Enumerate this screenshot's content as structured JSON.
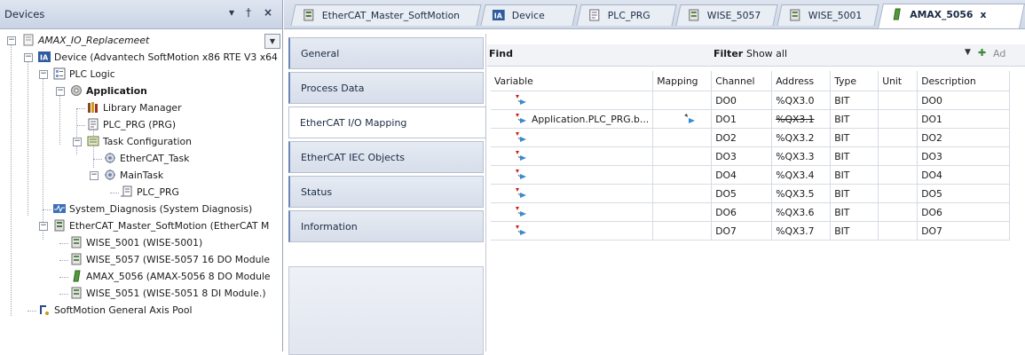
{
  "devices_panel": {
    "title": "Devices",
    "controls": {
      "dropdown": "▾",
      "pin": "†",
      "close": "×"
    },
    "tree": [
      {
        "label": "AMAX_IO_Replacemeet",
        "italic": true,
        "icon": "project-icon"
      },
      {
        "label": "Device (Advantech SoftMotion x86 RTE V3 x64",
        "icon": "device-icon"
      },
      {
        "label": "PLC Logic",
        "icon": "plc-logic-icon"
      },
      {
        "label": "Application",
        "bold": true,
        "icon": "application-icon"
      },
      {
        "label": "Library Manager",
        "icon": "library-icon"
      },
      {
        "label": "PLC_PRG (PRG)",
        "icon": "pou-icon"
      },
      {
        "label": "Task Configuration",
        "icon": "task-config-icon"
      },
      {
        "label": "EtherCAT_Task",
        "icon": "task-icon"
      },
      {
        "label": "MainTask",
        "icon": "task-icon"
      },
      {
        "label": "PLC_PRG",
        "icon": "pou-call-icon"
      },
      {
        "label": "System_Diagnosis (System Diagnosis)",
        "icon": "diagnosis-icon"
      },
      {
        "label": "EtherCAT_Master_SoftMotion (EtherCAT M",
        "icon": "ethercat-master-icon"
      },
      {
        "label": "WISE_5001 (WISE-5001)",
        "icon": "module-icon"
      },
      {
        "label": "WISE_5057 (WISE-5057 16 DO Module",
        "icon": "module-icon"
      },
      {
        "label": "AMAX_5056 (AMAX-5056 8 DO Module",
        "icon": "amax-module-icon"
      },
      {
        "label": "WISE_5051 (WISE-5051 8 DI Module.)",
        "icon": "module-icon"
      },
      {
        "label": "SoftMotion General Axis Pool",
        "icon": "axis-pool-icon"
      }
    ]
  },
  "tabs": [
    {
      "label": "EtherCAT_Master_SoftMotion",
      "icon": "ethercat-master-icon"
    },
    {
      "label": "Device",
      "icon": "device-icon"
    },
    {
      "label": "PLC_PRG",
      "icon": "pou-icon"
    },
    {
      "label": "WISE_5057",
      "icon": "module-icon"
    },
    {
      "label": "WISE_5001",
      "icon": "module-icon"
    },
    {
      "label": "AMAX_5056",
      "icon": "amax-module-icon",
      "active": true,
      "close": "x"
    }
  ],
  "subtabs": [
    {
      "label": "General"
    },
    {
      "label": "Process Data"
    },
    {
      "label": "EtherCAT I/O Mapping",
      "active": true
    },
    {
      "label": "EtherCAT IEC Objects"
    },
    {
      "label": "Status"
    },
    {
      "label": "Information"
    }
  ],
  "toolbar": {
    "find_label": "Find",
    "filter_label": "Filter",
    "filter_value": "Show all",
    "add_label": "Ad"
  },
  "table": {
    "columns": [
      "Variable",
      "Mapping",
      "Channel",
      "Address",
      "Type",
      "Unit",
      "Description"
    ],
    "rows": [
      {
        "variable": "",
        "mapped": false,
        "channel": "DO0",
        "address": "%QX3.0",
        "struck": false,
        "type": "BIT",
        "unit": "",
        "description": "DO0"
      },
      {
        "variable": "Application.PLC_PRG.b...",
        "mapped": true,
        "channel": "DO1",
        "address": "%QX3.1",
        "struck": true,
        "type": "BIT",
        "unit": "",
        "description": "DO1"
      },
      {
        "variable": "",
        "mapped": false,
        "channel": "DO2",
        "address": "%QX3.2",
        "struck": false,
        "type": "BIT",
        "unit": "",
        "description": "DO2"
      },
      {
        "variable": "",
        "mapped": false,
        "channel": "DO3",
        "address": "%QX3.3",
        "struck": false,
        "type": "BIT",
        "unit": "",
        "description": "DO3"
      },
      {
        "variable": "",
        "mapped": false,
        "channel": "DO4",
        "address": "%QX3.4",
        "struck": false,
        "type": "BIT",
        "unit": "",
        "description": "DO4"
      },
      {
        "variable": "",
        "mapped": false,
        "channel": "DO5",
        "address": "%QX3.5",
        "struck": false,
        "type": "BIT",
        "unit": "",
        "description": "DO5"
      },
      {
        "variable": "",
        "mapped": false,
        "channel": "DO6",
        "address": "%QX3.6",
        "struck": false,
        "type": "BIT",
        "unit": "",
        "description": "DO6"
      },
      {
        "variable": "",
        "mapped": false,
        "channel": "DO7",
        "address": "%QX3.7",
        "struck": false,
        "type": "BIT",
        "unit": "",
        "description": "DO7"
      }
    ]
  }
}
